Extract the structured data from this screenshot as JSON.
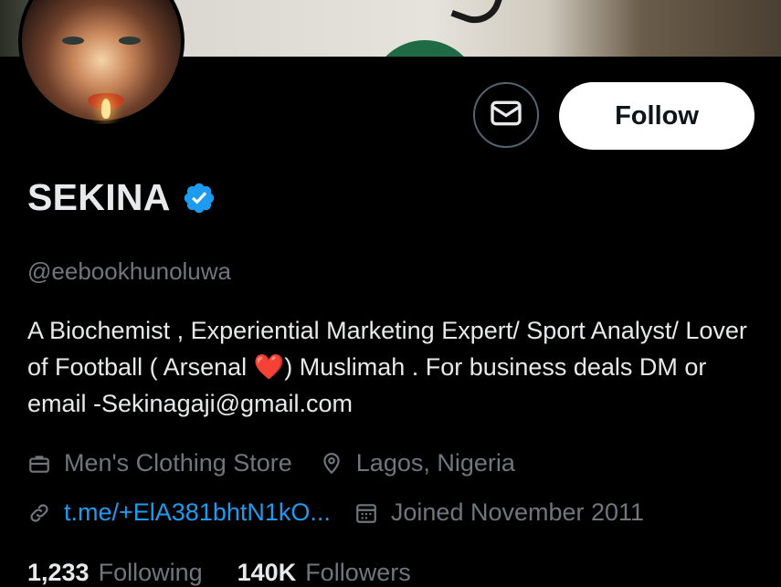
{
  "profile": {
    "display_name": "SEKINA",
    "handle": "@eebookhunoluwa",
    "bio_before_heart": "A Biochemist , Experiential Marketing Expert/ Sport Analyst/ Lover of Football ( Arsenal ",
    "bio_heart": "❤️",
    "bio_after_heart": ") Muslimah . For business deals DM or email -Sekinagaji@gmail.com",
    "verified_icon": "verified-badge-icon"
  },
  "actions": {
    "message_icon": "envelope-icon",
    "follow_label": "Follow"
  },
  "meta": {
    "category_icon": "briefcase-icon",
    "category": "Men's Clothing Store",
    "location_icon": "location-pin-icon",
    "location": "Lagos, Nigeria",
    "link_icon": "link-icon",
    "link": "t.me/+ElA381bhtN1kO...",
    "joined_icon": "calendar-icon",
    "joined": "Joined November 2011"
  },
  "stats": {
    "following_count": "1,233",
    "following_label": "Following",
    "followers_count": "140K",
    "followers_label": "Followers"
  },
  "colors": {
    "background": "#000000",
    "primary_text": "#e7e9ea",
    "secondary_text": "#71767b",
    "link": "#1d9bf0",
    "verified": "#1d9bf0",
    "follow_bg": "#ffffff"
  }
}
